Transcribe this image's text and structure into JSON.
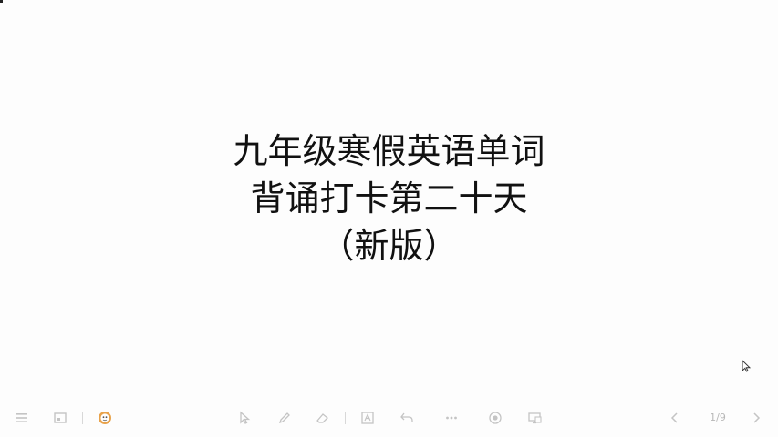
{
  "slide": {
    "title_lines": [
      "九年级寒假英语单词",
      "背诵打卡第二十天",
      "（新版）"
    ]
  },
  "toolbar": {
    "page_indicator": "1/9",
    "icons": [
      "menu-icon",
      "slide-thumbnail-icon",
      "avatar-icon",
      "pointer-icon",
      "pen-icon",
      "eraser-icon",
      "text-icon",
      "undo-icon",
      "more-icon",
      "record-icon",
      "screen-icon",
      "previous-icon",
      "next-icon"
    ],
    "icon_color": "#c4c4c4",
    "avatar_color": "#e8a24a"
  }
}
